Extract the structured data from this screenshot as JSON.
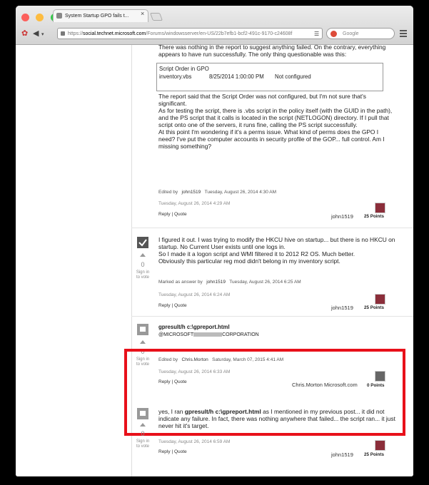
{
  "browser": {
    "tab_title": "System Startup GPO fails t...",
    "url_scheme": "https://",
    "url_host": "social.technet.microsoft.com",
    "url_path": "/Forums/windowsserver/en-US/22b7efb1-bcf2-491c-9170-c24608f",
    "search_placeholder": "Google"
  },
  "post1": {
    "paragraphs": [
      "There was nothing in the report to suggest anything failed.  On the contrary, everything appears to have run successfully.  The only thing questionable was this:"
    ],
    "table": {
      "header": "Script Order in GPO",
      "cells": [
        "inventory.vbs",
        "8/25/2014 1:00:00 PM",
        "Not configured"
      ]
    },
    "paragraphs2": [
      "The report said that the Script Order was not configured, but I'm not sure that's significant.",
      "As for testing the script, there is .vbs script in the policy itself (with the GUID in the path), and the PS script that it calls is located in the script (NETLOGON) directory.  If I pull that script onto one of the servers, it runs fine, calling the PS script successfully.",
      "At this point I'm wondering if it's a perms issue.  What kind of perms does the GPO I need?  I've put the computer accounts in  security profile of the GOP... full control.  Am I missing something?"
    ],
    "edited_label": "Edited by",
    "edited_user": "john1519",
    "edited_date": "Tuesday, August 26, 2014 4:30 AM",
    "date": "Tuesday, August 26, 2014 4:29 AM",
    "reply": "Reply",
    "quote": "Quote",
    "sep": "|",
    "author": "john1519",
    "points": "25 Points"
  },
  "post2": {
    "paragraphs": [
      "I figured it out.  I was trying to modify the HKCU hive on startup... but there is no HKCU on startup. No Current User exists until one logs in.",
      "So I made it a logon script and WMI filtered it to 2012 R2 OS. Much better.",
      "Obviously this particular reg mod didn't belong in my inventory script."
    ],
    "vote_count": "0",
    "vote_label_1": "Sign in",
    "vote_label_2": "to vote",
    "marked_label": "Marked as answer by",
    "marked_user": "john1519",
    "marked_date": "Tuesday, August 26, 2014 6:25 AM",
    "date": "Tuesday, August 26, 2014 6:24 AM",
    "reply": "Reply",
    "quote": "Quote",
    "sep": "|",
    "author": "john1519",
    "points": "25 Points"
  },
  "post3": {
    "command": "gpresult/h c:\\gpreport.html",
    "signature_prefix": "@MICROSOFT",
    "signature_suffix": "CORPORATION",
    "vote_count": "0",
    "vote_label_1": "Sign in",
    "vote_label_2": "to vote",
    "edited_label": "Edited by",
    "edited_user": "Chris.Morton",
    "edited_date": "Saturday, March 07, 2015 4:41 AM",
    "date": "Tuesday, August 26, 2014 6:33 AM",
    "reply": "Reply",
    "quote": "Quote",
    "sep": "|",
    "author": "Chris.Morton",
    "author_org": "Microsoft.com",
    "points": "0 Points"
  },
  "post4": {
    "text_before": "yes, I ran ",
    "command": "gpresult/h c:\\gpreport.html",
    "text_after": " as I mentioned in my previous post... it did not indicate any failure.  In fact, there was nothing anywhere that failed... the script ran... it just never hit it's target.",
    "vote_count": "0",
    "vote_label_1": "Sign in",
    "vote_label_2": "to vote",
    "date": "Tuesday, August 26, 2014 6:59 AM",
    "reply": "Reply",
    "quote": "Quote",
    "sep": "|",
    "author": "john1519",
    "points": "25 Points"
  },
  "colors": {
    "highlight": "#e8101a",
    "answer_check": "#555555",
    "avatar": "#8b2e3a"
  }
}
